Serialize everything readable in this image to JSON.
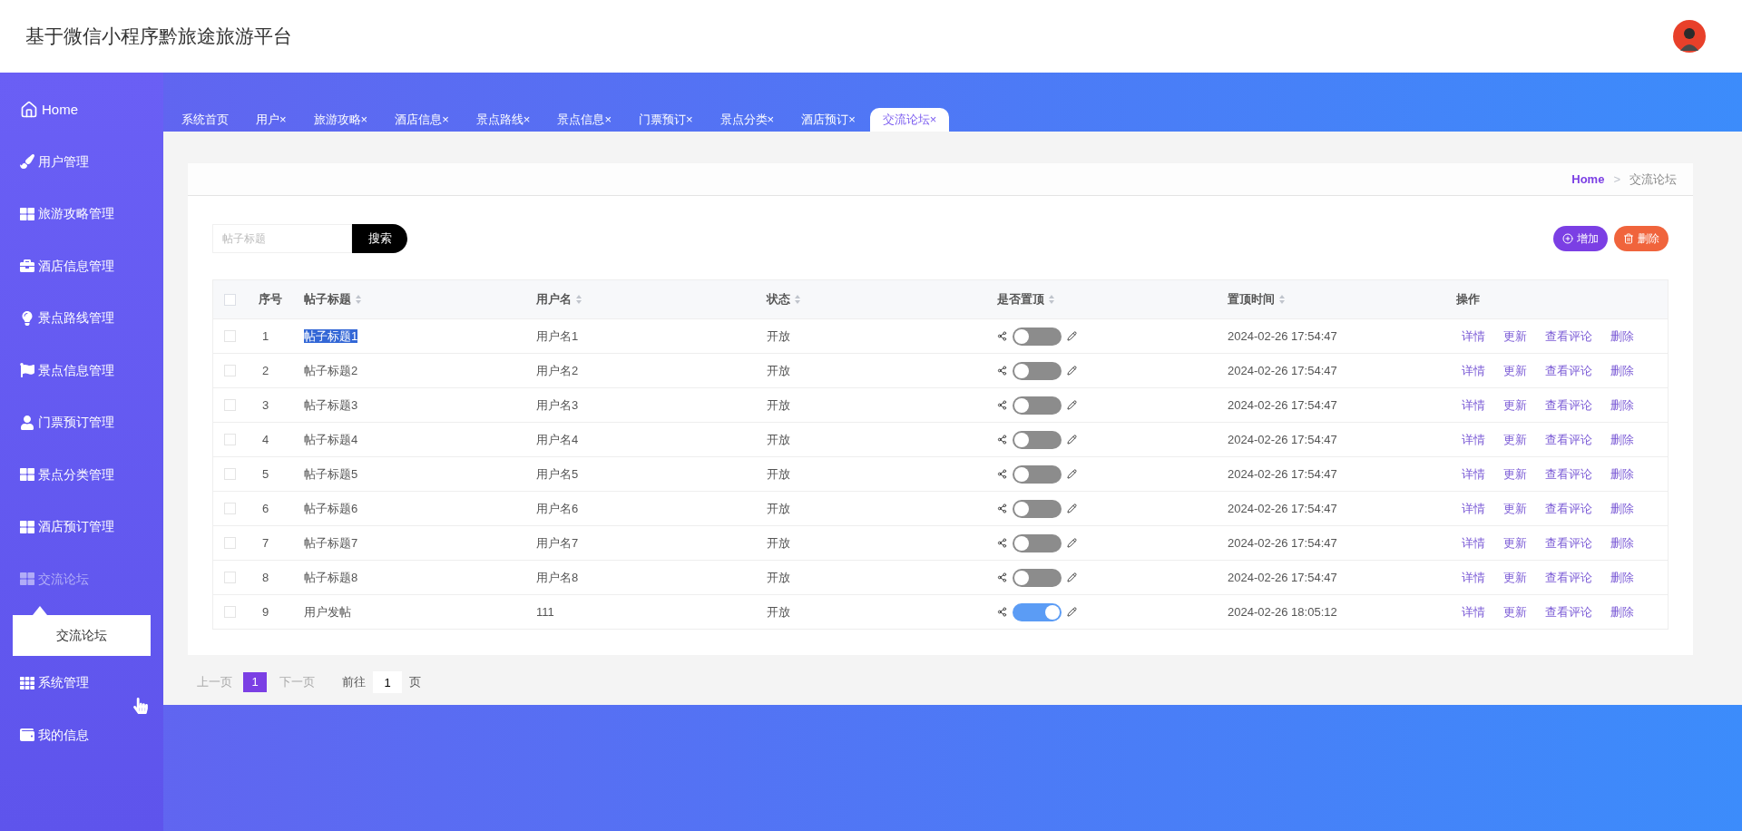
{
  "header": {
    "title": "基于微信小程序黔旅途旅游平台"
  },
  "sidebar": {
    "items": [
      {
        "label": "Home",
        "expanded": false
      },
      {
        "label": "用户管理",
        "expanded": false
      },
      {
        "label": "旅游攻略管理",
        "expanded": false
      },
      {
        "label": "酒店信息管理",
        "expanded": false
      },
      {
        "label": "景点路线管理",
        "expanded": false
      },
      {
        "label": "景点信息管理",
        "expanded": false
      },
      {
        "label": "门票预订管理",
        "expanded": false
      },
      {
        "label": "景点分类管理",
        "expanded": false
      },
      {
        "label": "酒店预订管理",
        "expanded": false
      },
      {
        "label": "交流论坛",
        "expanded": true,
        "children": [
          {
            "label": "交流论坛"
          }
        ]
      },
      {
        "label": "系统管理",
        "expanded": false
      },
      {
        "label": "我的信息",
        "expanded": false
      }
    ]
  },
  "tabs": [
    {
      "label": "系统首页",
      "selected": false
    },
    {
      "label": "用户",
      "close": "×",
      "selected": false
    },
    {
      "label": "旅游攻略",
      "close": "×",
      "selected": false
    },
    {
      "label": "酒店信息",
      "close": "×",
      "selected": false
    },
    {
      "label": "景点路线",
      "close": "×",
      "selected": false
    },
    {
      "label": "景点信息",
      "close": "×",
      "selected": false
    },
    {
      "label": "门票预订",
      "close": "×",
      "selected": false
    },
    {
      "label": "景点分类",
      "close": "×",
      "selected": false
    },
    {
      "label": "酒店预订",
      "close": "×",
      "selected": false
    },
    {
      "label": "交流论坛",
      "close": "×",
      "selected": true
    }
  ],
  "breadcrumb": {
    "home": "Home",
    "separator": ">",
    "current": "交流论坛"
  },
  "search": {
    "placeholder": "帖子标题",
    "button": "搜索"
  },
  "toolbar": {
    "add": "增加",
    "delete": "删除"
  },
  "table": {
    "select_all_checked": false,
    "columns": [
      {
        "label": "序号",
        "sortable": false
      },
      {
        "label": "帖子标题",
        "sortable": true
      },
      {
        "label": "用户名",
        "sortable": true
      },
      {
        "label": "状态",
        "sortable": true
      },
      {
        "label": "是否置顶",
        "sortable": true
      },
      {
        "label": "置顶时间",
        "sortable": true
      },
      {
        "label": "操作",
        "sortable": false
      }
    ],
    "rows": [
      {
        "index": "1",
        "checked": false,
        "title": "帖子标题1",
        "title_highlighted": true,
        "user": "用户名1",
        "status": "开放",
        "pinned": false,
        "time": "2024-02-26 17:54:47",
        "actions": [
          "详情",
          "更新",
          "查看评论",
          "删除"
        ]
      },
      {
        "index": "2",
        "checked": false,
        "title": "帖子标题2",
        "title_highlighted": false,
        "user": "用户名2",
        "status": "开放",
        "pinned": false,
        "time": "2024-02-26 17:54:47",
        "actions": [
          "详情",
          "更新",
          "查看评论",
          "删除"
        ]
      },
      {
        "index": "3",
        "checked": false,
        "title": "帖子标题3",
        "title_highlighted": false,
        "user": "用户名3",
        "status": "开放",
        "pinned": false,
        "time": "2024-02-26 17:54:47",
        "actions": [
          "详情",
          "更新",
          "查看评论",
          "删除"
        ]
      },
      {
        "index": "4",
        "checked": false,
        "title": "帖子标题4",
        "title_highlighted": false,
        "user": "用户名4",
        "status": "开放",
        "pinned": false,
        "time": "2024-02-26 17:54:47",
        "actions": [
          "详情",
          "更新",
          "查看评论",
          "删除"
        ]
      },
      {
        "index": "5",
        "checked": false,
        "title": "帖子标题5",
        "title_highlighted": false,
        "user": "用户名5",
        "status": "开放",
        "pinned": false,
        "time": "2024-02-26 17:54:47",
        "actions": [
          "详情",
          "更新",
          "查看评论",
          "删除"
        ]
      },
      {
        "index": "6",
        "checked": false,
        "title": "帖子标题6",
        "title_highlighted": false,
        "user": "用户名6",
        "status": "开放",
        "pinned": false,
        "time": "2024-02-26 17:54:47",
        "actions": [
          "详情",
          "更新",
          "查看评论",
          "删除"
        ]
      },
      {
        "index": "7",
        "checked": false,
        "title": "帖子标题7",
        "title_highlighted": false,
        "user": "用户名7",
        "status": "开放",
        "pinned": false,
        "time": "2024-02-26 17:54:47",
        "actions": [
          "详情",
          "更新",
          "查看评论",
          "删除"
        ]
      },
      {
        "index": "8",
        "checked": false,
        "title": "帖子标题8",
        "title_highlighted": false,
        "user": "用户名8",
        "status": "开放",
        "pinned": false,
        "time": "2024-02-26 17:54:47",
        "actions": [
          "详情",
          "更新",
          "查看评论",
          "删除"
        ]
      },
      {
        "index": "9",
        "checked": false,
        "title": "用户发帖",
        "title_highlighted": false,
        "user": "111",
        "status": "开放",
        "pinned": true,
        "time": "2024-02-26 18:05:12",
        "actions": [
          "详情",
          "更新",
          "查看评论",
          "删除"
        ]
      }
    ]
  },
  "pagination": {
    "prev": "上一页",
    "pages": [
      {
        "label": "1",
        "selected": true
      }
    ],
    "next": "下一页",
    "goto": "前往",
    "goto_value": "1",
    "goto_suffix": "页"
  }
}
